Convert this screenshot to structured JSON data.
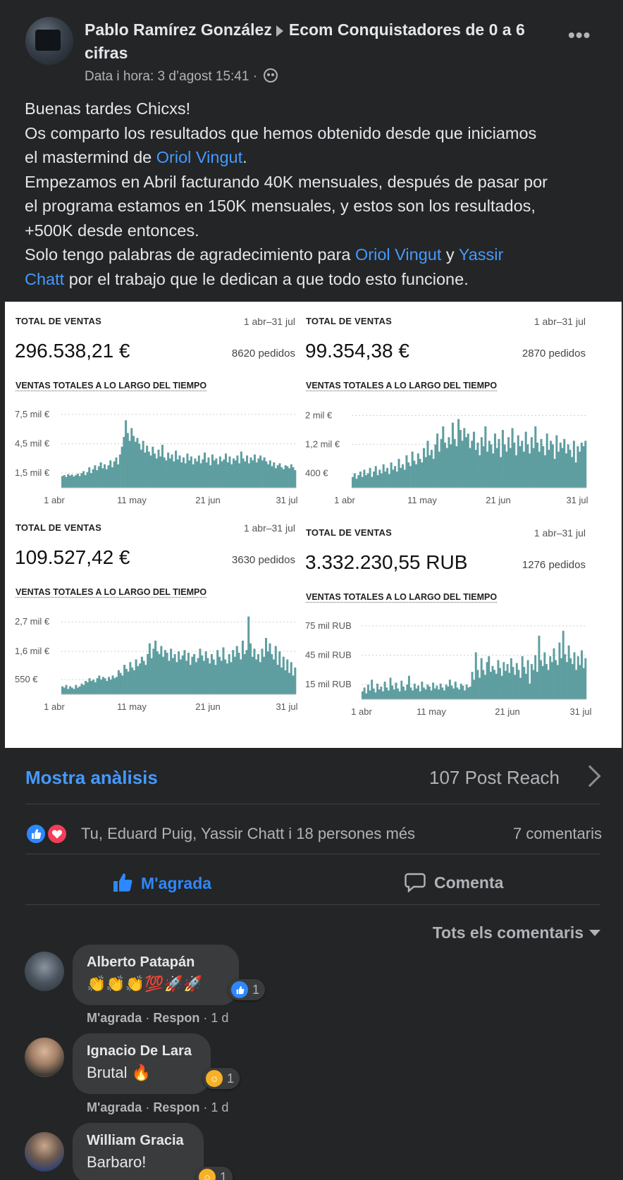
{
  "post": {
    "author": "Pablo Ramírez González",
    "group": "Ecom Conquistadores de 0 a 6 cifras",
    "meta": "Data i hora: 3 d’agost 15:41 ·",
    "more_icon": "more-options-icon",
    "body": [
      [
        "Buenas tardes Chicxs!"
      ],
      [
        "Os comparto los resultados que hemos obtenido desde que iniciamos"
      ],
      [
        "el mastermind de ",
        {
          "link": "Oriol Vingut"
        },
        "."
      ],
      [
        "Empezamos en Abril facturando 40K mensuales, después de pasar por"
      ],
      [
        "el programa estamos en 150K mensuales, y estos son los resultados,"
      ],
      [
        "+500K desde entonces."
      ],
      [
        "Solo tengo palabras de agradecimiento para ",
        {
          "link": "Oriol Vingut"
        },
        " y ",
        {
          "link": "Yassir"
        }
      ],
      [
        {
          "link": "Chatt"
        },
        " por el trabajo que le dedican a que todo esto funcione."
      ]
    ]
  },
  "chart_labels": {
    "title": "TOTAL DE VENTAS",
    "range": "1 abr–31 jul",
    "subtitle": "VENTAS TOTALES A LO LARGO DEL TIEMPO"
  },
  "chart_data": [
    {
      "type": "bar",
      "total": "296.538,21 €",
      "orders": "8620 pedidos",
      "yticks": [
        "7,5 mil €",
        "4,5 mil €",
        "1,5 mil €"
      ],
      "ytick_values": [
        7500,
        4500,
        1500
      ],
      "ylim": [
        0,
        8500
      ],
      "xticks": [
        "1 abr",
        "11 may",
        "21 jun",
        "31 jul"
      ],
      "x": "daily 1 abr – 31 jul",
      "values": [
        1200,
        1300,
        1100,
        1400,
        1250,
        1350,
        1150,
        1300,
        1450,
        1200,
        1500,
        1700,
        1300,
        1600,
        2100,
        1500,
        1900,
        2300,
        1800,
        2200,
        2600,
        2000,
        2400,
        1900,
        2300,
        2800,
        2100,
        2700,
        3100,
        2400,
        3400,
        4200,
        5200,
        6900,
        5600,
        4800,
        6100,
        5300,
        4700,
        5100,
        4500,
        3900,
        4800,
        3600,
        4300,
        3700,
        3300,
        4200,
        3500,
        3000,
        3900,
        3200,
        4400,
        3100,
        2800,
        3600,
        3000,
        3400,
        2700,
        3800,
        2900,
        3300,
        2600,
        3100,
        2500,
        3500,
        2800,
        3200,
        2400,
        3000,
        2700,
        3300,
        2500,
        2900,
        3600,
        2600,
        3100,
        2300,
        3400,
        2800,
        3000,
        2400,
        3200,
        2700,
        2900,
        3500,
        2600,
        3200,
        2400,
        3000,
        2800,
        3300,
        2500,
        3700,
        3000,
        2700,
        3300,
        2500,
        3100,
        2800,
        3400,
        2600,
        3000,
        3300,
        2800,
        3100,
        2700,
        2400,
        2800,
        2200,
        2600,
        2000,
        2300,
        2500,
        2100,
        1900,
        2300,
        2200,
        2000,
        2400,
        2100,
        1800
      ]
    },
    {
      "type": "bar",
      "total": "99.354,38 €",
      "orders": "2870 pedidos",
      "yticks": [
        "2 mil €",
        "1,2 mil €",
        "400 €"
      ],
      "ytick_values": [
        2000,
        1200,
        400
      ],
      "ylim": [
        0,
        2300
      ],
      "xticks": [
        "1 abr",
        "11 may",
        "21 jun",
        "31 jul"
      ],
      "x": "daily 1 abr – 31 jul",
      "values": [
        300,
        400,
        250,
        350,
        450,
        300,
        500,
        350,
        400,
        550,
        300,
        450,
        600,
        350,
        500,
        400,
        650,
        450,
        550,
        380,
        700,
        500,
        600,
        450,
        800,
        550,
        650,
        500,
        900,
        700,
        600,
        1000,
        750,
        650,
        950,
        800,
        700,
        1100,
        850,
        1300,
        900,
        1050,
        800,
        1200,
        1500,
        1000,
        1350,
        1700,
        1250,
        1100,
        1400,
        1200,
        1800,
        1350,
        1150,
        1900,
        1600,
        1300,
        1650,
        1400,
        1500,
        1100,
        1300,
        1550,
        1050,
        1250,
        900,
        1400,
        1150,
        1700,
        1000,
        1300,
        1200,
        950,
        1500,
        1100,
        1350,
        850,
        1600,
        1200,
        1000,
        1400,
        1100,
        1650,
        1250,
        900,
        1450,
        1150,
        1300,
        1000,
        1550,
        1200,
        950,
        1400,
        1100,
        1700,
        1250,
        1000,
        1350,
        1150,
        900,
        1500,
        1050,
        1300,
        1200,
        800,
        1450,
        1000,
        1250,
        1100,
        1350,
        950,
        1200,
        1050,
        850,
        1300,
        700,
        1150,
        1000,
        1250,
        1150,
        1300
      ]
    },
    {
      "type": "bar",
      "total": "109.527,42 €",
      "orders": "3630 pedidos",
      "yticks": [
        "2,7 mil €",
        "1,6 mil €",
        "550 €"
      ],
      "ytick_values": [
        2700,
        1600,
        550
      ],
      "ylim": [
        0,
        3100
      ],
      "xticks": [
        "1 abr",
        "11 may",
        "21 jun",
        "31 jul"
      ],
      "x": "daily 1 abr – 31 jul",
      "values": [
        300,
        250,
        350,
        200,
        300,
        250,
        200,
        350,
        250,
        300,
        400,
        350,
        500,
        450,
        600,
        500,
        550,
        450,
        600,
        700,
        550,
        650,
        600,
        500,
        650,
        550,
        700,
        600,
        650,
        900,
        800,
        700,
        1100,
        950,
        850,
        1200,
        1000,
        900,
        1300,
        1050,
        1150,
        1400,
        1250,
        1100,
        1500,
        1900,
        1350,
        1700,
        2000,
        1600,
        1500,
        1800,
        1400,
        1650,
        1550,
        1250,
        1700,
        1350,
        1500,
        1200,
        1600,
        1300,
        1450,
        1650,
        1250,
        1550,
        1100,
        1400,
        1500,
        1200,
        1350,
        1700,
        1450,
        1250,
        1600,
        1350,
        1150,
        1500,
        1300,
        1100,
        1650,
        1400,
        1250,
        1750,
        1300,
        1150,
        1500,
        1200,
        1650,
        1400,
        1800,
        1550,
        1300,
        2000,
        1500,
        1650,
        2900,
        1900,
        1400,
        1700,
        1300,
        1500,
        1200,
        1700,
        1400,
        2100,
        1600,
        1900,
        1500,
        1300,
        1800,
        1100,
        1600,
        1000,
        1400,
        900,
        1300,
        800,
        1200,
        700,
        1000
      ]
    },
    {
      "type": "bar",
      "total": "3.332.230,55 RUB",
      "orders": "1276 pedidos",
      "yticks": [
        "75 mil RUB",
        "45 mil RUB",
        "15 mil RUB"
      ],
      "ytick_values": [
        75000,
        45000,
        15000
      ],
      "ylim": [
        0,
        85000
      ],
      "xticks": [
        "1 abr",
        "11 may",
        "21 jun",
        "31 jul"
      ],
      "x": "daily 1 abr – 31 jul",
      "values": [
        8000,
        12000,
        6000,
        15000,
        9000,
        20000,
        11000,
        7000,
        16000,
        10000,
        13000,
        8000,
        18000,
        12000,
        9000,
        22000,
        14000,
        10000,
        17000,
        11000,
        8000,
        19000,
        13000,
        9000,
        15000,
        24000,
        12000,
        9000,
        16000,
        11000,
        14000,
        8000,
        18000,
        12000,
        10000,
        15000,
        13000,
        9000,
        17000,
        11000,
        14000,
        10000,
        16000,
        12000,
        9000,
        15000,
        13000,
        20000,
        14000,
        11000,
        18000,
        12000,
        10000,
        16000,
        14000,
        9000,
        15000,
        12000,
        13000,
        28000,
        20000,
        48000,
        30000,
        22000,
        42000,
        30000,
        25000,
        38000,
        44000,
        28000,
        34000,
        30000,
        26000,
        40000,
        32000,
        24000,
        38000,
        29000,
        36000,
        27000,
        42000,
        33000,
        25000,
        37000,
        30000,
        22000,
        44000,
        33000,
        26000,
        40000,
        16000,
        36000,
        30000,
        45000,
        28000,
        65000,
        40000,
        34000,
        48000,
        36000,
        30000,
        44000,
        38000,
        52000,
        40000,
        35000,
        58000,
        42000,
        70000,
        46000,
        38000,
        55000,
        42000,
        36000,
        48000,
        30000,
        44000,
        35000,
        50000,
        32000,
        42000
      ]
    }
  ],
  "insights": {
    "label": "Mostra anàlisis",
    "reach": "107 Post Reach"
  },
  "reactions": {
    "names": "Tu, Eduard Puig, Yassir Chatt i 18 persones més",
    "comments": "7 comentaris"
  },
  "actions": {
    "like": "M'agrada",
    "comment": "Comenta"
  },
  "filter": {
    "label": "Tots els comentaris"
  },
  "comments": [
    {
      "name": "Alberto Patapán",
      "text": "👏👏👏💯🚀🚀",
      "reaction_count": "1",
      "reaction": "like",
      "like": "M'agrada",
      "reply": "Respon",
      "time": "· 1 d"
    },
    {
      "name": "Ignacio De Lara",
      "text": "Brutal 🔥",
      "reaction_count": "1",
      "reaction": "care",
      "like": "M'agrada",
      "reply": "Respon",
      "time": "· 1 d"
    },
    {
      "name": "William Gracia",
      "text": "Barbaro!",
      "reaction_count": "1",
      "reaction": "care",
      "like": "",
      "reply": "",
      "time": ""
    }
  ],
  "colors": {
    "bg": "#242526",
    "link": "#4599ff",
    "bar": "#5f9ea0",
    "muted": "#b0b3b8"
  }
}
